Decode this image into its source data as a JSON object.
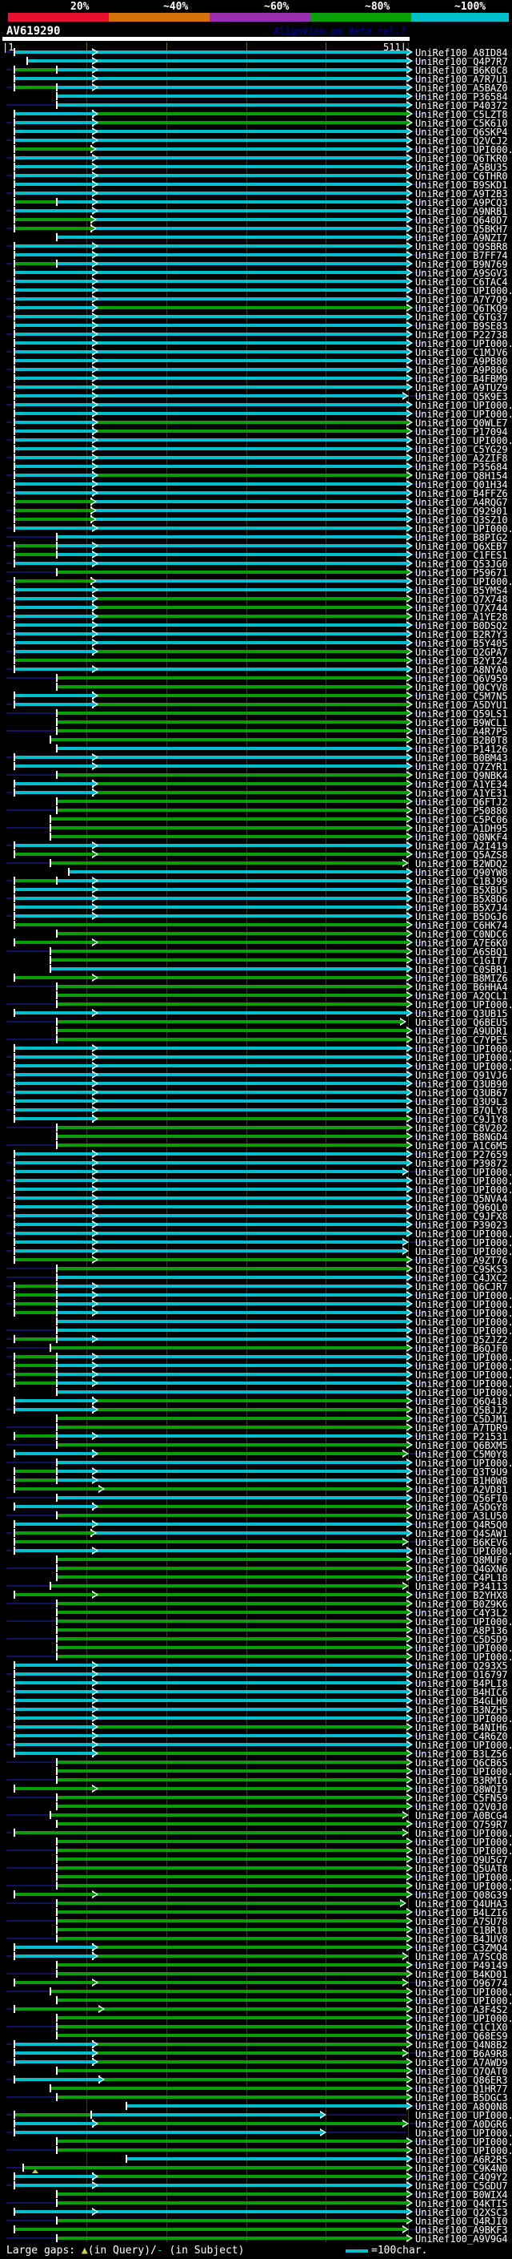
{
  "header": {
    "accession": "AV619290",
    "app": "AlignView.pm Beta rel.7"
  },
  "identity_key": {
    "labels": [
      "20%",
      "~40%",
      "~60%",
      "~80%",
      "~100%"
    ],
    "colors": [
      "#e8102d",
      "#d2720b",
      "#9b2fae",
      "#089f08",
      "#00c0cd"
    ],
    "bounds": [
      10,
      136,
      262,
      388,
      514,
      636
    ]
  },
  "ruler": {
    "start_label": "|1",
    "end_label": "511|"
  },
  "legend": {
    "prefix": "Large gaps: ",
    "gap_query_marker": "▲",
    "gap_query_text": "(in Query)/",
    "gap_subject_marker": "-",
    "gap_subject_text": " (in Subject)",
    "scale_text": "=100char."
  },
  "chart_data": {
    "type": "alignment-overview",
    "title": "AV619290",
    "query": {
      "name": "AV619290",
      "length": 511,
      "axis_start": 1,
      "axis_end": 511
    },
    "gridlines_x": [
      108,
      208,
      308,
      407,
      510
    ],
    "colors": {
      "cyan": "#00c0cd",
      "green": "#089f08",
      "navy": "#11115c"
    },
    "row_prefix": "UniRef100_",
    "patterns": {
      "c": {
        "segs": [
          [
            17,
            508,
            "cyan"
          ]
        ],
        "mid": [
          115,
          "cyan"
        ]
      },
      "c33": {
        "segs": [
          [
            33,
            508,
            "cyan"
          ]
        ],
        "mid": [
          115,
          "cyan"
        ]
      },
      "c62": {
        "segs": [
          [
            62,
            508,
            "cyan"
          ]
        ]
      },
      "c70": {
        "segs": [
          [
            70,
            508,
            "cyan"
          ]
        ]
      },
      "c85": {
        "segs": [
          [
            85,
            508,
            "cyan"
          ]
        ]
      },
      "c157": {
        "segs": [
          [
            157,
            508,
            "cyan"
          ]
        ]
      },
      "cn70": {
        "segs": [
          [
            8,
            70,
            "navy"
          ],
          [
            70,
            508,
            "cyan"
          ]
        ]
      },
      "cS": {
        "segs": [
          [
            17,
            503,
            "cyan"
          ]
        ],
        "mid": [
          115,
          "cyan"
        ]
      },
      "c400": {
        "segs": [
          [
            17,
            400,
            "cyan"
          ],
          [
            400,
            508,
            "navy"
          ]
        ],
        "end": 400
      },
      "cg": {
        "segs": [
          [
            17,
            115,
            "cyan"
          ],
          [
            115,
            508,
            "green"
          ]
        ],
        "mid": [
          115,
          "cyan"
        ]
      },
      "cgS": {
        "segs": [
          [
            17,
            115,
            "cyan"
          ],
          [
            115,
            503,
            "green"
          ]
        ],
        "mid": [
          115,
          "cyan"
        ]
      },
      "cg140": {
        "segs": [
          [
            17,
            123,
            "cyan"
          ],
          [
            123,
            508,
            "green"
          ]
        ],
        "mid": [
          123,
          "cyan"
        ]
      },
      "gc70": {
        "segs": [
          [
            17,
            70,
            "green"
          ],
          [
            70,
            508,
            "cyan"
          ]
        ],
        "mid": [
          115,
          "cyan"
        ]
      },
      "gc113": {
        "segs": [
          [
            17,
            113,
            "green"
          ],
          [
            113,
            508,
            "cyan"
          ]
        ],
        "mid": [
          113,
          "green"
        ]
      },
      "gc400": {
        "segs": [
          [
            17,
            113,
            "green"
          ],
          [
            113,
            400,
            "cyan"
          ],
          [
            400,
            508,
            "navy"
          ]
        ],
        "end": 400
      },
      "g": {
        "segs": [
          [
            17,
            508,
            "green"
          ]
        ]
      },
      "g17m": {
        "segs": [
          [
            17,
            508,
            "green"
          ]
        ],
        "mid": [
          115,
          "green"
        ]
      },
      "g123": {
        "segs": [
          [
            17,
            508,
            "green"
          ]
        ],
        "mid": [
          123,
          "green"
        ]
      },
      "gS": {
        "segs": [
          [
            17,
            503,
            "green"
          ]
        ]
      },
      "gSm": {
        "segs": [
          [
            17,
            503,
            "green"
          ]
        ],
        "mid": [
          115,
          "green"
        ]
      },
      "g62": {
        "segs": [
          [
            62,
            508,
            "green"
          ]
        ]
      },
      "g70": {
        "segs": [
          [
            70,
            508,
            "green"
          ]
        ]
      },
      "gn28": {
        "segs": [
          [
            8,
            28,
            "navy"
          ],
          [
            28,
            508,
            "green"
          ]
        ],
        "gap": 44
      },
      "gn62": {
        "segs": [
          [
            8,
            62,
            "navy"
          ],
          [
            62,
            508,
            "green"
          ]
        ]
      },
      "gn62S": {
        "segs": [
          [
            8,
            62,
            "navy"
          ],
          [
            62,
            503,
            "green"
          ]
        ]
      },
      "gn70": {
        "segs": [
          [
            8,
            70,
            "navy"
          ],
          [
            70,
            508,
            "green"
          ]
        ]
      },
      "gn70S": {
        "segs": [
          [
            8,
            70,
            "navy"
          ],
          [
            70,
            500,
            "green"
          ]
        ]
      }
    },
    "rows": [
      [
        "A8ID84",
        "c"
      ],
      [
        "Q4P7R7",
        "c33"
      ],
      [
        "B6K0C8",
        "gc70"
      ],
      [
        "A7R7U1",
        "c"
      ],
      [
        "A5BAZ0",
        "gc70"
      ],
      [
        "P36584",
        "c70"
      ],
      [
        "P40372",
        "cn70"
      ],
      [
        "C5LZT8",
        "cg"
      ],
      [
        "C5K610",
        "cg"
      ],
      [
        "Q6SKP4",
        "c"
      ],
      [
        "Q2VCJ2",
        "c"
      ],
      [
        "UPI000..",
        "gc113"
      ],
      [
        "Q6TKR0",
        "c"
      ],
      [
        "A5BU35",
        "c"
      ],
      [
        "C6THR0",
        "c"
      ],
      [
        "B9SKD1",
        "c"
      ],
      [
        "A9T2B3",
        "c"
      ],
      [
        "A9PCQ3",
        "gc70"
      ],
      [
        "A9NRB1",
        "c"
      ],
      [
        "Q640D7",
        "gc113"
      ],
      [
        "Q5BKH7",
        "gc113"
      ],
      [
        "A9NZI7",
        "c70"
      ],
      [
        "Q9SBR8",
        "c"
      ],
      [
        "B7FF74",
        "c"
      ],
      [
        "B9N769",
        "gc70"
      ],
      [
        "A9SGV3",
        "c"
      ],
      [
        "C6TAC4",
        "c"
      ],
      [
        "UPI000..",
        "c"
      ],
      [
        "A7Y7Q9",
        "c"
      ],
      [
        "Q6TKQ9",
        "cg"
      ],
      [
        "C6TG37",
        "c"
      ],
      [
        "B9SE83",
        "c"
      ],
      [
        "P22738",
        "c"
      ],
      [
        "UPI000..",
        "c"
      ],
      [
        "C1MJV6",
        "c"
      ],
      [
        "A9PB80",
        "c"
      ],
      [
        "A9P806",
        "c"
      ],
      [
        "B4FBM9",
        "c"
      ],
      [
        "A9TUZ9",
        "c"
      ],
      [
        "Q5K9E3",
        "cS"
      ],
      [
        "UPI000..",
        "c"
      ],
      [
        "UPI000..",
        "c"
      ],
      [
        "Q0WLE7",
        "cg"
      ],
      [
        "P17094",
        "cg"
      ],
      [
        "UPI000..",
        "c"
      ],
      [
        "C5YG29",
        "c"
      ],
      [
        "A2ZIF8",
        "c"
      ],
      [
        "P35684",
        "c"
      ],
      [
        "Q8H154",
        "cg"
      ],
      [
        "Q01H34",
        "c"
      ],
      [
        "B4FFZ6",
        "c"
      ],
      [
        "A4RQG7",
        "gc113"
      ],
      [
        "Q92901",
        "gc113"
      ],
      [
        "Q3SZ10",
        "gc113"
      ],
      [
        "UPI000..",
        "c"
      ],
      [
        "B8PIG2",
        "cn70"
      ],
      [
        "Q6XEB7",
        "gc70"
      ],
      [
        "C1FES1",
        "gc70"
      ],
      [
        "Q53JG0",
        "c"
      ],
      [
        "P59671",
        "gn70"
      ],
      [
        "UPI000..",
        "gc113"
      ],
      [
        "B5YMS4",
        "c"
      ],
      [
        "Q7X748",
        "cg"
      ],
      [
        "Q7X744",
        "cg"
      ],
      [
        "A1YE28",
        "cg"
      ],
      [
        "B0DSQ2",
        "c"
      ],
      [
        "B2R7Y3",
        "c"
      ],
      [
        "B5Y405",
        "c"
      ],
      [
        "Q2GPA7",
        "cg"
      ],
      [
        "B2YI24",
        "g"
      ],
      [
        "A8NYA0",
        "c"
      ],
      [
        "Q6V959",
        "gn70"
      ],
      [
        "Q0CYV8",
        "g70"
      ],
      [
        "C5M7N5",
        "cg"
      ],
      [
        "A5DYU1",
        "cg"
      ],
      [
        "Q59LS1",
        "gn70"
      ],
      [
        "B9WCL1",
        "g70"
      ],
      [
        "A4R7P5",
        "gn70"
      ],
      [
        "B2B0T8",
        "g62"
      ],
      [
        "P14126",
        "c70"
      ],
      [
        "B0BM43",
        "c"
      ],
      [
        "Q7ZYR1",
        "c"
      ],
      [
        "Q9NBK4",
        "gn70"
      ],
      [
        "A1YE34",
        "cg"
      ],
      [
        "A1YE31",
        "cg"
      ],
      [
        "Q6FTJ2",
        "g70"
      ],
      [
        "P50880",
        "gn70"
      ],
      [
        "C5PC06",
        "g62"
      ],
      [
        "A1DH95",
        "gn62"
      ],
      [
        "Q8NKF4",
        "g62"
      ],
      [
        "A2I419",
        "c"
      ],
      [
        "Q5AZS8",
        "g17m"
      ],
      [
        "B2WDQ2",
        "gn62S"
      ],
      [
        "Q90YW8",
        "c85"
      ],
      [
        "C1BJ99",
        "gc70"
      ],
      [
        "B5XBU5",
        "c"
      ],
      [
        "B5X8D6",
        "c"
      ],
      [
        "B5X7J4",
        "c"
      ],
      [
        "B5DGJ6",
        "c"
      ],
      [
        "C6HK74",
        "g"
      ],
      [
        "C0NDC6",
        "g70"
      ],
      [
        "A7E6K0",
        "g17m"
      ],
      [
        "A6SBQ1",
        "gn62"
      ],
      [
        "C1GIT7",
        "g62"
      ],
      [
        "C0SBR1",
        "c62"
      ],
      [
        "B8MIZ6",
        "g17m"
      ],
      [
        "B6HHA4",
        "gn70"
      ],
      [
        "A2QCL1",
        "g70"
      ],
      [
        "UPI000..",
        "gn70"
      ],
      [
        "Q3UB15",
        "c"
      ],
      [
        "Q6BEU5",
        "gn70S"
      ],
      [
        "A9UDR1",
        "g70"
      ],
      [
        "C7YPE5",
        "gn70"
      ],
      [
        "UPI000..",
        "c"
      ],
      [
        "UPI000..",
        "c"
      ],
      [
        "UPI000..",
        "c"
      ],
      [
        "Q91VJ6",
        "c"
      ],
      [
        "Q3UB90",
        "c"
      ],
      [
        "Q3UB67",
        "c"
      ],
      [
        "Q3U9L3",
        "c"
      ],
      [
        "B7QLY8",
        "c"
      ],
      [
        "C9J1Y8",
        "cg"
      ],
      [
        "C8V202",
        "gn70"
      ],
      [
        "B8NGD4",
        "g70"
      ],
      [
        "A1C6M5",
        "gn70"
      ],
      [
        "P27659",
        "c"
      ],
      [
        "P39872",
        "c"
      ],
      [
        "UPI000..",
        "cS"
      ],
      [
        "UPI000..",
        "c"
      ],
      [
        "UPI000..",
        "c"
      ],
      [
        "Q5NVA4",
        "c"
      ],
      [
        "Q96QL0",
        "c"
      ],
      [
        "C9JFX8",
        "c"
      ],
      [
        "P39023",
        "c"
      ],
      [
        "UPI000..",
        "c"
      ],
      [
        "UPI000..",
        "cS"
      ],
      [
        "UPI000..",
        "cS"
      ],
      [
        "A9ZT76",
        "g17m"
      ],
      [
        "C9SKS3",
        "gn70"
      ],
      [
        "C4JXC2",
        "cn70"
      ],
      [
        "Q6CJR7",
        "gc70"
      ],
      [
        "UPI000..",
        "gc70"
      ],
      [
        "UPI000..",
        "gc70"
      ],
      [
        "UPI000..",
        "gc70"
      ],
      [
        "UPI000..",
        "c70"
      ],
      [
        "UPI000..",
        "cn70"
      ],
      [
        "Q5ZJZ2",
        "gc70"
      ],
      [
        "B6QJF0",
        "gn62"
      ],
      [
        "UPI000..",
        "gc70"
      ],
      [
        "UPI000..",
        "gc70"
      ],
      [
        "UPI000..",
        "gc70"
      ],
      [
        "UPI000..",
        "gc70"
      ],
      [
        "UPI000..",
        "c70"
      ],
      [
        "Q6Q418",
        "cg"
      ],
      [
        "Q5BJJ2",
        "cg"
      ],
      [
        "C5DJM1",
        "g70"
      ],
      [
        "A7TDR9",
        "gn70"
      ],
      [
        "P21531",
        "gc70"
      ],
      [
        "Q6BXM5",
        "gn70"
      ],
      [
        "C5M0Y8",
        "cgS"
      ],
      [
        "UPI000..",
        "cn70"
      ],
      [
        "Q3T9U9",
        "gc70"
      ],
      [
        "B1H0W8",
        "gc70"
      ],
      [
        "A2VD81",
        "g123"
      ],
      [
        "Q56FI0",
        "cn70"
      ],
      [
        "A5DGY8",
        "cg"
      ],
      [
        "A3LU50",
        "gn70"
      ],
      [
        "Q4R5Q0",
        "c"
      ],
      [
        "Q4SAW1",
        "gc113"
      ],
      [
        "B6KEV6",
        "gS"
      ],
      [
        "UPI000..",
        "c"
      ],
      [
        "Q8MUF0",
        "g70"
      ],
      [
        "Q4GXN6",
        "gn70"
      ],
      [
        "C4PL18",
        "g70"
      ],
      [
        "P34113",
        "gn62S"
      ],
      [
        "B2YHX8",
        "g17m"
      ],
      [
        "B0Z9K6",
        "gn70"
      ],
      [
        "C4Y3L2",
        "g70"
      ],
      [
        "UPI000..",
        "gn70"
      ],
      [
        "A8P136",
        "g70"
      ],
      [
        "C5DSD9",
        "gn70"
      ],
      [
        "UPI000..",
        "g70"
      ],
      [
        "UPI000..",
        "gn70"
      ],
      [
        "Q293X5",
        "c"
      ],
      [
        "O16797",
        "c"
      ],
      [
        "B4PLI8",
        "c"
      ],
      [
        "B4HIC6",
        "c"
      ],
      [
        "B4GLH0",
        "c"
      ],
      [
        "B3NZH5",
        "c"
      ],
      [
        "UPI000..",
        "c"
      ],
      [
        "B4NIH6",
        "cg"
      ],
      [
        "C4R6Z0",
        "c"
      ],
      [
        "UPI000..",
        "c"
      ],
      [
        "B3LZ56",
        "cg"
      ],
      [
        "Q6CB65",
        "gn70"
      ],
      [
        "UPI000..",
        "g70"
      ],
      [
        "B3RMI6",
        "gn70"
      ],
      [
        "Q8WQI9",
        "g17m"
      ],
      [
        "C5FN59",
        "gn70"
      ],
      [
        "Q2V0J0",
        "g70"
      ],
      [
        "A0BCG4",
        "gn62S"
      ],
      [
        "Q759R7",
        "g70"
      ],
      [
        "UPI000..",
        "gS"
      ],
      [
        "UPI000..",
        "g70"
      ],
      [
        "UPI000..",
        "gn70"
      ],
      [
        "Q9U5G7",
        "g70"
      ],
      [
        "Q5UAT8",
        "gn70"
      ],
      [
        "UPI000..",
        "g70"
      ],
      [
        "UPI000..",
        "gn70"
      ],
      [
        "Q08G39",
        "g17m"
      ],
      [
        "Q4UHA3",
        "gn70S"
      ],
      [
        "B4LZI6",
        "g70"
      ],
      [
        "A7SU78",
        "gn70"
      ],
      [
        "C1BR10",
        "g70"
      ],
      [
        "B4JUV8",
        "gn70"
      ],
      [
        "C3ZMQ4",
        "cg"
      ],
      [
        "A7SCQ8",
        "cgS"
      ],
      [
        "P49149",
        "g70"
      ],
      [
        "B4KD01",
        "gn70"
      ],
      [
        "O96774",
        "gSm"
      ],
      [
        "UPI000..",
        "gn62"
      ],
      [
        "UPI000..",
        "g70"
      ],
      [
        "A3F4S2",
        "g123"
      ],
      [
        "UPI000..",
        "g70"
      ],
      [
        "C1C1X0",
        "gn70"
      ],
      [
        "Q68ES9",
        "g70"
      ],
      [
        "Q4N8B2",
        "cg"
      ],
      [
        "B6A9R8",
        "cgS"
      ],
      [
        "A7AWD9",
        "cg"
      ],
      [
        "Q7QAT0",
        "g70"
      ],
      [
        "Q86ER3",
        "cg140"
      ],
      [
        "Q1HR77",
        "g62"
      ],
      [
        "B5DGC3",
        "gn70"
      ],
      [
        "A8Q0N8",
        "c157"
      ],
      [
        "UPI000..",
        "gc400"
      ],
      [
        "A0DGR6",
        "cgS"
      ],
      [
        "UPI000..",
        "c400"
      ],
      [
        "UPI000..",
        "g70"
      ],
      [
        "UPI000..",
        "gn70"
      ],
      [
        "A6R2R5",
        "c157"
      ],
      [
        "C9K4N0",
        "gn28"
      ],
      [
        "C4Q9Y2",
        "cg"
      ],
      [
        "C5GDU7",
        "c"
      ],
      [
        "B0WIX4",
        "g70"
      ],
      [
        "Q4KTI5",
        "gn70"
      ],
      [
        "Q2XSC3",
        "c"
      ],
      [
        "Q4RJI0",
        "gn70"
      ],
      [
        "A9BKF3",
        "gS"
      ],
      [
        "A9V9G4",
        "gn70"
      ]
    ]
  }
}
